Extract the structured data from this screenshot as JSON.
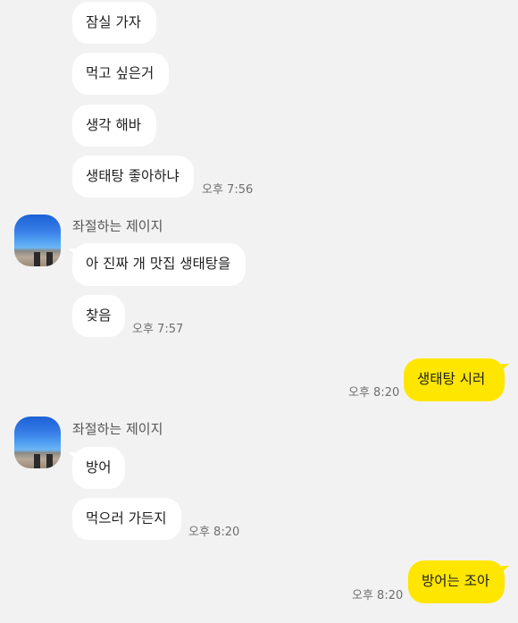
{
  "colors": {
    "background": "#f2f2f2",
    "incoming_bubble": "#ffffff",
    "outgoing_bubble": "#ffe600"
  },
  "messages": {
    "m1": "잠실 가자",
    "m2": "먹고 싶은거",
    "m3": "생각 해바",
    "m4": "생태탕 좋아하냐",
    "m5": "아 진짜 개 맛집 생태탕을",
    "m6": "찾음",
    "m7": "생태탕 시러",
    "m8": "방어",
    "m9": "먹으러 가든지",
    "m10": "방어는 조아"
  },
  "times": {
    "t1": "오후 7:56",
    "t2": "오후 7:57",
    "t3": "오후 8:20",
    "t4": "오후 8:20",
    "t5": "오후 8:20"
  },
  "senders": {
    "s1": "좌절하는 제이지",
    "s2": "좌절하는 제이지"
  },
  "icons": {
    "avatar": "profile-avatar-image"
  }
}
